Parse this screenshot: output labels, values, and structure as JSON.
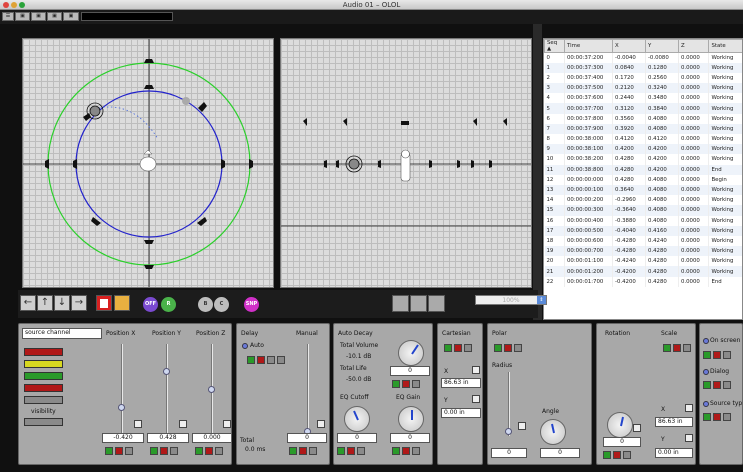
{
  "window": {
    "title": "Audio 01 – OLOL"
  },
  "toolbar": {
    "buttons": [
      "",
      "",
      "",
      "",
      ""
    ]
  },
  "table": {
    "headers": [
      "Seq ▲",
      "Time",
      "X",
      "Y",
      "Z",
      "State"
    ],
    "rows": [
      [
        "0",
        "00:00:37:200",
        "-0.0040",
        "-0.0080",
        "0.0000",
        "Working"
      ],
      [
        "1",
        "00:00:37:300",
        "0.0840",
        "0.1280",
        "0.0000",
        "Working"
      ],
      [
        "2",
        "00:00:37:400",
        "0.1720",
        "0.2560",
        "0.0000",
        "Working"
      ],
      [
        "3",
        "00:00:37:500",
        "0.2120",
        "0.3240",
        "0.0000",
        "Working"
      ],
      [
        "4",
        "00:00:37:600",
        "0.2440",
        "0.3480",
        "0.0000",
        "Working"
      ],
      [
        "5",
        "00:00:37:700",
        "0.3120",
        "0.3840",
        "0.0000",
        "Working"
      ],
      [
        "6",
        "00:00:37:800",
        "0.3560",
        "0.4080",
        "0.0000",
        "Working"
      ],
      [
        "7",
        "00:00:37:900",
        "0.3920",
        "0.4080",
        "0.0000",
        "Working"
      ],
      [
        "8",
        "00:00:38:000",
        "0.4120",
        "0.4120",
        "0.0000",
        "Working"
      ],
      [
        "9",
        "00:00:38:100",
        "0.4200",
        "0.4200",
        "0.0000",
        "Working"
      ],
      [
        "10",
        "00:00:38:200",
        "0.4280",
        "0.4200",
        "0.0000",
        "Working"
      ],
      [
        "11",
        "00:00:38:800",
        "0.4280",
        "0.4200",
        "0.0000",
        "End"
      ],
      [
        "12",
        "00:00:00:000",
        "0.4280",
        "0.4080",
        "0.0000",
        "Begin"
      ],
      [
        "13",
        "00:00:00:100",
        "0.3640",
        "0.4080",
        "0.0000",
        "Working"
      ],
      [
        "14",
        "00:00:00:200",
        "-0.2960",
        "0.4080",
        "0.0000",
        "Working"
      ],
      [
        "15",
        "00:00:00:300",
        "-0.3640",
        "0.4080",
        "0.0000",
        "Working"
      ],
      [
        "16",
        "00:00:00:400",
        "-0.3880",
        "0.4080",
        "0.0000",
        "Working"
      ],
      [
        "17",
        "00:00:00:500",
        "-0.4040",
        "0.4160",
        "0.0000",
        "Working"
      ],
      [
        "18",
        "00:00:00:600",
        "-0.4280",
        "0.4240",
        "0.0000",
        "Working"
      ],
      [
        "19",
        "00:00:00:700",
        "-0.4280",
        "0.4280",
        "0.0000",
        "Working"
      ],
      [
        "20",
        "00:00:01:100",
        "-0.4240",
        "0.4280",
        "0.0000",
        "Working"
      ],
      [
        "21",
        "00:00:01:200",
        "-0.4200",
        "0.4280",
        "0.0000",
        "Working"
      ],
      [
        "22",
        "00:00:01:700",
        "-0.4200",
        "0.4280",
        "0.0000",
        "End"
      ]
    ]
  },
  "controls": {
    "off_label": "OFF",
    "r_label": "R",
    "b_label": "B",
    "c_label": "C",
    "snp_label": "SNP",
    "zoom": "100%",
    "zoom_arrow": "⇕",
    "arrows": [
      "←",
      "↑",
      "↓",
      "→"
    ]
  },
  "source": {
    "channel": "source channel",
    "visibility": "visibility"
  },
  "position": {
    "x_label": "Position X",
    "y_label": "Position Y",
    "z_label": "Position Z",
    "x": "-0.420",
    "y": "0.428",
    "z": "0.000",
    "x_level": 0.29,
    "y_level": 0.71,
    "z_level": 0.5
  },
  "delay": {
    "label": "Delay",
    "auto": "Auto",
    "manual": "Manual",
    "total_label": "Total",
    "total_value": "0.0 ms",
    "manual_value": "0"
  },
  "auto_decay": {
    "label": "Auto Decay",
    "total_volume_label": "Total Volume",
    "total_volume": "-10.1 dB",
    "total_life_label": "Total Life",
    "total_life": "-50.0 dB",
    "life_value": "0",
    "eq_cutoff": "EQ Cutoff",
    "eq_gain": "EQ Gain",
    "cutoff_value": "0",
    "gain_value": "0"
  },
  "cartesian": {
    "label": "Cartesian",
    "x_label": "X",
    "x_value": "86.63 in",
    "y_label": "Y",
    "y_value": "0.00 in"
  },
  "polar": {
    "label": "Polar",
    "radius_label": "Radius",
    "angle_label": "Angle",
    "radius_value": "0",
    "angle_value": "0"
  },
  "rotation": {
    "label": "Rotation",
    "scale_label": "Scale",
    "value": "0",
    "x_label": "X",
    "x_value": "86.63 in",
    "y_label": "Y",
    "y_value": "0.00 in"
  },
  "options": {
    "on_screen": "On screen",
    "dialog": "Dialog",
    "source_type": "Source type"
  }
}
